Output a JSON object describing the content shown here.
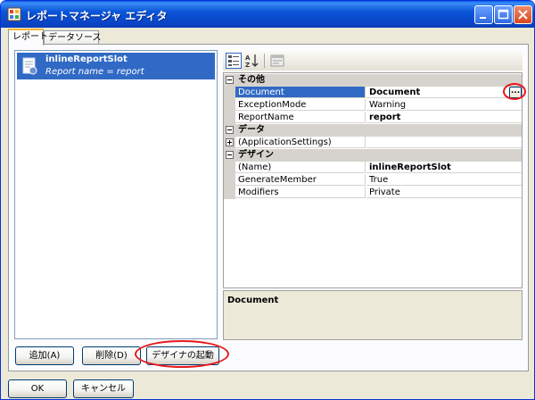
{
  "window": {
    "title": "レポートマネージャ エディタ"
  },
  "tabs": [
    {
      "label": "レポート"
    },
    {
      "label": "データソース"
    }
  ],
  "report_list": {
    "items": [
      {
        "name": "inlineReportSlot",
        "subtitle": "Report name = report"
      }
    ]
  },
  "property_grid": {
    "categories": [
      {
        "label": "その他",
        "rows": [
          {
            "name": "Document",
            "value": "Document",
            "selected": true
          },
          {
            "name": "ExceptionMode",
            "value": "Warning"
          },
          {
            "name": "ReportName",
            "value": "report"
          }
        ]
      },
      {
        "label": "データ",
        "rows": [
          {
            "name": "(ApplicationSettings)",
            "value": ""
          }
        ]
      },
      {
        "label": "デザイン",
        "rows": [
          {
            "name": "(Name)",
            "value": "inlineReportSlot"
          },
          {
            "name": "GenerateMember",
            "value": "True"
          },
          {
            "name": "Modifiers",
            "value": "Private"
          }
        ]
      }
    ],
    "ellipsis_label": "...",
    "description_title": "Document"
  },
  "buttons": {
    "add": "追加(A)",
    "delete": "削除(D)",
    "launch_designer": "デザイナの起動",
    "ok": "OK",
    "cancel": "キャンセル"
  },
  "colors": {
    "selection": "#316ac5",
    "highlight_circle": "#e8181c",
    "titlebar": "#0a55d8"
  }
}
